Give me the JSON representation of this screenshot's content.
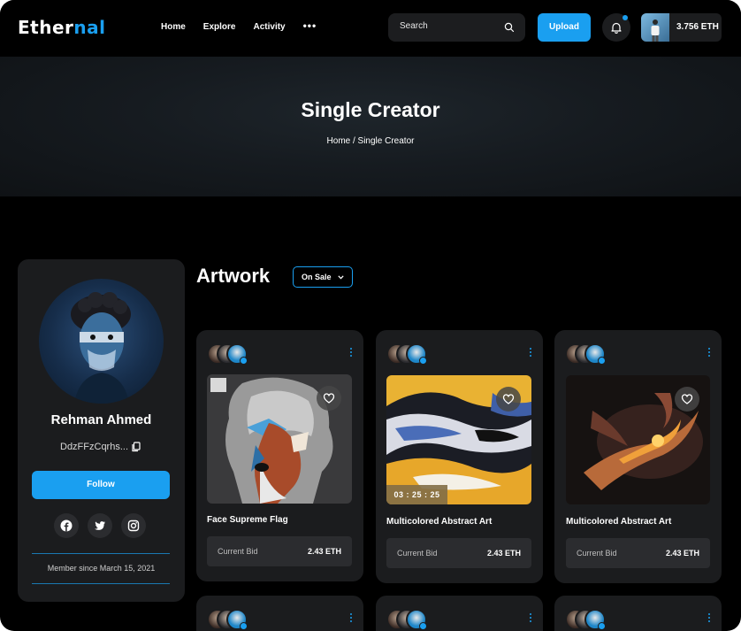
{
  "header": {
    "logo_main": "Ether",
    "logo_accent": "nal",
    "nav": [
      "Home",
      "Explore",
      "Activity"
    ],
    "nav_more": "•••",
    "search_placeholder": "Search",
    "upload_label": "Upload",
    "wallet_balance": "3.756 ETH"
  },
  "hero": {
    "title": "Single Creator",
    "breadcrumb": "Home / Single Creator"
  },
  "profile": {
    "name": "Rehman Ahmed",
    "address": "DdzFFzCqrhs...",
    "follow_label": "Follow",
    "socials": [
      "facebook-icon",
      "twitter-icon",
      "instagram-icon"
    ],
    "member_since": "Member since March 15, 2021"
  },
  "artwork": {
    "title": "Artwork",
    "filter": "On Sale",
    "cards": [
      {
        "name": "Face Supreme Flag",
        "bid_label": "Current Bid",
        "bid_value": "2.43 ETH",
        "timer": ""
      },
      {
        "name": "Multicolored Abstract Art",
        "bid_label": "Current Bid",
        "bid_value": "2.43 ETH",
        "timer": "03 : 25 : 25"
      },
      {
        "name": "Multicolored Abstract Art",
        "bid_label": "Current Bid",
        "bid_value": "2.43 ETH",
        "timer": ""
      }
    ]
  },
  "colors": {
    "accent": "#1a9ff0",
    "card": "#1b1c1e",
    "background": "#000000"
  }
}
